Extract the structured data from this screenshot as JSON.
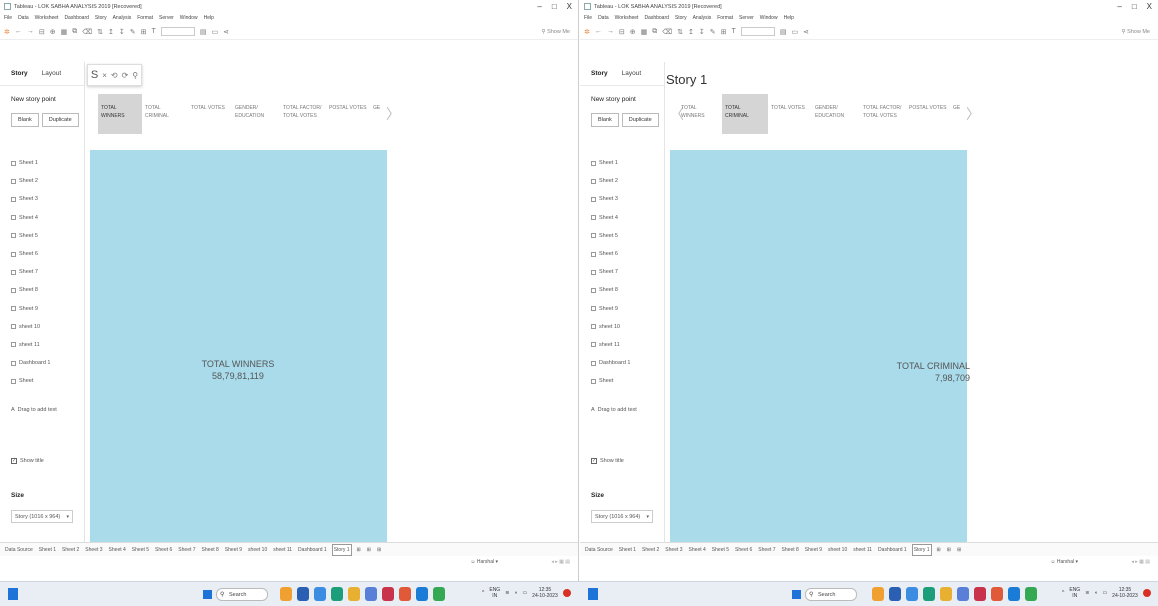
{
  "left": {
    "title": "Tableau - LOK SABHA ANALYSIS 2019 [Recovered]",
    "menu": [
      "File",
      "Data",
      "Worksheet",
      "Dashboard",
      "Story",
      "Analysis",
      "Format",
      "Server",
      "Window",
      "Help"
    ],
    "show_me": "Show Me",
    "float_icons": [
      "S",
      "×",
      "⟲",
      "⟳",
      "⚲"
    ],
    "story_title": "",
    "active_point": 0,
    "viz_label": "TOTAL WINNERS",
    "viz_value": "58,79,81,119"
  },
  "right": {
    "title": "Tableau - LOK SABHA ANALYSIS 2019 [Recovered]",
    "menu": [
      "File",
      "Data",
      "Worksheet",
      "Dashboard",
      "Story",
      "Analysis",
      "Format",
      "Server",
      "Window",
      "Help"
    ],
    "show_me": "Show Me",
    "story_title": "Story 1",
    "active_point": 1,
    "viz_label": "TOTAL CRIMINAL",
    "viz_value": "7,98,709"
  },
  "window_controls": [
    "–",
    "□",
    "X"
  ],
  "sidebar": {
    "tab_story": "Story",
    "tab_layout": "Layout",
    "new_story_point": "New story point",
    "blank": "Blank",
    "duplicate": "Duplicate",
    "sheets": [
      "Sheet 1",
      "Sheet 2",
      "Sheet 3",
      "Sheet 4",
      "Sheet 5",
      "Sheet 6",
      "Sheet 7",
      "Sheet 8",
      "Sheet 9",
      "sheet 10",
      "sheet 11",
      "Dashboard 1",
      "Sheet"
    ],
    "drag_text": "Drag to add text",
    "show_title": "Show title",
    "size_heading": "Size",
    "size_value": "Story (1016 x 964)"
  },
  "story_points": [
    "TOTAL WINNERS",
    "TOTAL CRIMINAL",
    "TOTAL VOTES",
    "GENDER/ EDUCATION",
    "TOTAL FACTOR/ TOTAL VOTES",
    "POSTAL VOTES",
    "GE"
  ],
  "sheet_tabs": [
    "Data Source",
    "Sheet 1",
    "Sheet 2",
    "Sheet 3",
    "Sheet 4",
    "Sheet 5",
    "Sheet 6",
    "Sheet 7",
    "Sheet 8",
    "Sheet 9",
    "sheet 10",
    "sheet 11",
    "Dashboard 1",
    "Story 1"
  ],
  "status_user": "Harshal",
  "taskbar": {
    "search": "Search",
    "lang": "ENG",
    "lang2": "IN",
    "time": "12:35",
    "date": "24-10-2023"
  },
  "colors": {
    "viz": "#a9dbeb",
    "accent": "#e8833a",
    "win_blue": "#1e73d8"
  }
}
